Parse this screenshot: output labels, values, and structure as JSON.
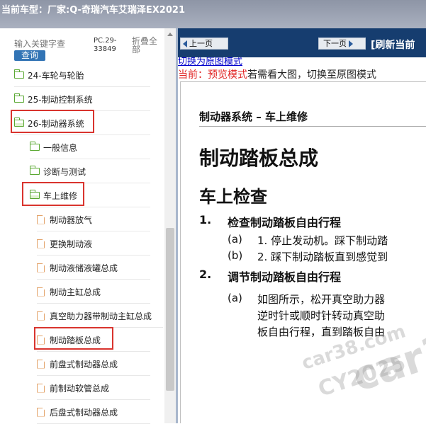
{
  "title": {
    "prefix": "当前车型：",
    "model": "厂家:Q-奇瑞汽车艾瑞泽EX2021"
  },
  "search": {
    "placeholder": "输入关键字查",
    "button": "查询",
    "pc_code": "PC.29-33849",
    "collapse_all": "折叠全部"
  },
  "tree": [
    {
      "id": "24",
      "label": "24-车轮与轮胎",
      "type": "folder"
    },
    {
      "id": "25",
      "label": "25-制动控制系统",
      "type": "folder"
    },
    {
      "id": "26",
      "label": "26-制动器系统",
      "type": "folder-open"
    },
    {
      "id": "gen",
      "label": "一般信息",
      "type": "folder"
    },
    {
      "id": "diag",
      "label": "诊断与测试",
      "type": "folder"
    },
    {
      "id": "onveh",
      "label": "车上维修",
      "type": "folder-open"
    },
    {
      "id": "d1",
      "label": "制动器放气",
      "type": "doc"
    },
    {
      "id": "d2",
      "label": "更换制动液",
      "type": "doc"
    },
    {
      "id": "d3",
      "label": "制动液储液罐总成",
      "type": "doc"
    },
    {
      "id": "d4",
      "label": "制动主缸总成",
      "type": "doc"
    },
    {
      "id": "d5",
      "label": "真空助力器带制动主缸总成",
      "type": "doc"
    },
    {
      "id": "d6",
      "label": "制动踏板总成",
      "type": "doc"
    },
    {
      "id": "d7",
      "label": "前盘式制动器总成",
      "type": "doc"
    },
    {
      "id": "d8",
      "label": "前制动软管总成",
      "type": "doc"
    },
    {
      "id": "d9",
      "label": "后盘式制动器总成",
      "type": "doc"
    }
  ],
  "nav": {
    "prev": "上一页",
    "next": "下一页",
    "refresh": "[刷新当前"
  },
  "switch_link": "切换为原图模式",
  "preview": {
    "current": "当前：",
    "mode": "预览模式",
    "hint": "若需看大图，切换至原图模式"
  },
  "document": {
    "section": "制动器系统 – 车上维修",
    "heading": "制动踏板总成",
    "subheading": "车上检查",
    "steps": [
      {
        "num": "1.",
        "title": "检查制动踏板自由行程"
      },
      {
        "num": "2.",
        "title": "调节制动踏板自由行程"
      }
    ],
    "sub_a1": {
      "label": "(a)",
      "text": "1. 停止发动机。踩下制动踏"
    },
    "sub_b1": {
      "label": "(b)",
      "text": "2. 踩下制动踏板直到感觉到"
    },
    "sub_a2": {
      "label": "(a)",
      "line1": "如图所示，松开真空助力器",
      "line2": "逆时针或顺时针转动真空助",
      "line3": "板自由行程，直到踏板自由"
    }
  },
  "watermarks": {
    "w1": "car38",
    "w2": "car38.com",
    "w3": "CY2025"
  },
  "colors": {
    "highlight": "#d9342e",
    "navbar": "#163d6f",
    "query_button": "#3274b5"
  }
}
